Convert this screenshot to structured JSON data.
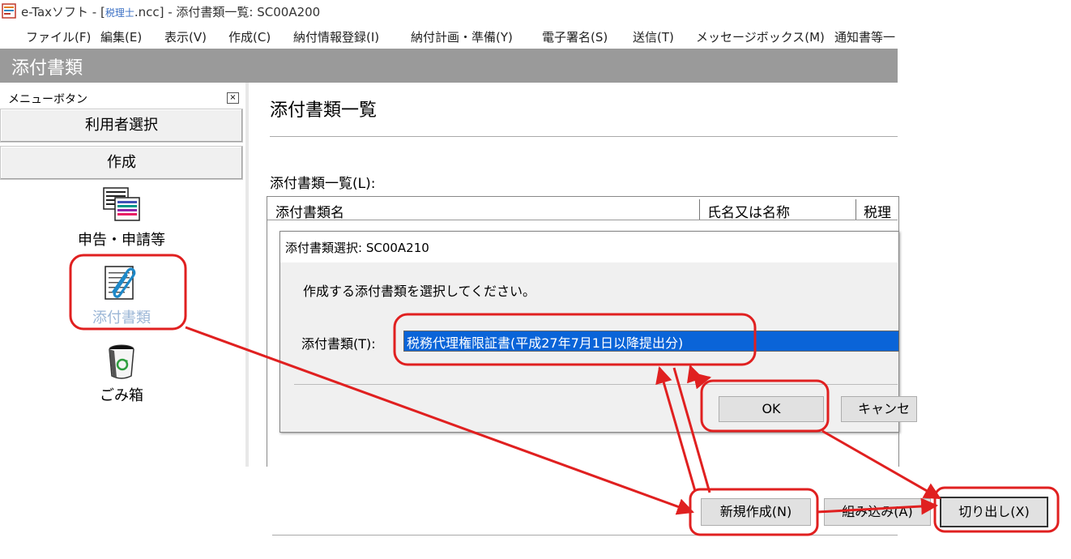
{
  "window": {
    "title_prefix": "e-Taxソフト - [",
    "title_file": "税理士",
    "title_suffix": ".ncc] - 添付書類一覧: SC00A200"
  },
  "menubar": {
    "items": [
      "ファイル(F)",
      "編集(E)",
      "表示(V)",
      "作成(C)",
      "納付情報登録(I)",
      "納付計画・準備(Y)",
      "電子署名(S)",
      "送信(T)",
      "メッセージボックス(M)",
      "通知書等一"
    ]
  },
  "header": {
    "title": "添付書類"
  },
  "sidebar": {
    "menu_label": "メニューボタン",
    "close_glyph": "×",
    "buttons": [
      "利用者選択",
      "作成"
    ],
    "icons": [
      {
        "label": "申告・申請等",
        "icon": "document-list-icon"
      },
      {
        "label": "添付書類",
        "icon": "paperclip-document-icon",
        "selected": true
      },
      {
        "label": "ごみ箱",
        "icon": "recycle-bin-icon"
      }
    ]
  },
  "main": {
    "title": "添付書類一覧",
    "list_label": "添付書類一覧(L):",
    "columns": [
      "添付書類名",
      "氏名又は名称",
      "税理"
    ]
  },
  "dialog": {
    "title": "添付書類選択: SC00A210",
    "prompt": "作成する添付書類を選択してください。",
    "field_label": "添付書類(T):",
    "selected_value": "税務代理権限証書(平成27年7月1日以降提出分)",
    "ok_label": "OK",
    "cancel_label": "キャンセル"
  },
  "actions": {
    "new_label": "新規作成(N)",
    "import_label": "組み込み(A)",
    "cut_label": "切り出し(X)"
  },
  "colors": {
    "header_bg": "#9a9a9a",
    "selection_blue": "#0a64d8",
    "annotation_red": "#e02020",
    "selected_icon_label": "#9bb6d6"
  }
}
